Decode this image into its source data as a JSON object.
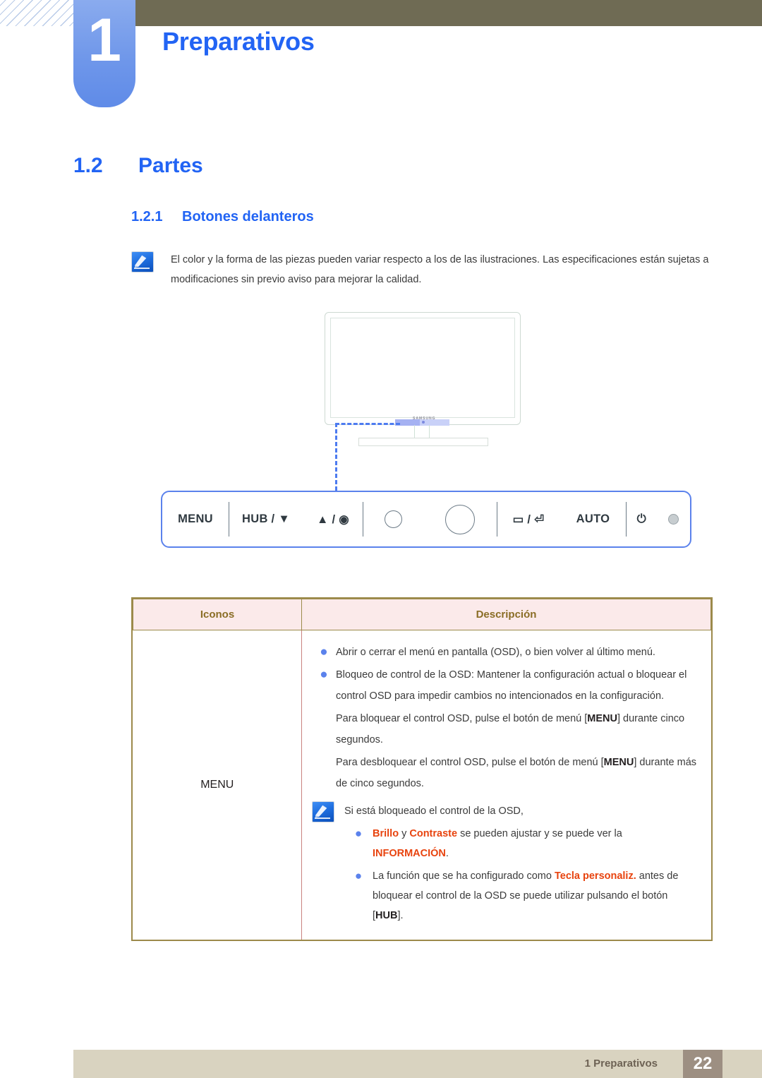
{
  "header": {
    "chapter_number": "1",
    "chapter_title": "Preparativos"
  },
  "headings": {
    "h1_number": "1.2",
    "h1_title": "Partes",
    "h2_number": "1.2.1",
    "h2_title": "Botones delanteros"
  },
  "note": {
    "icon": "note-pencil-icon",
    "text": "El color y la forma de las piezas pueden variar respecto a los de las ilustraciones. Las especificaciones están sujetas a modificaciones sin previo aviso para mejorar la calidad."
  },
  "illustration": {
    "name": "front-monitor-illustration",
    "brand_logo": "SAMSUNG"
  },
  "control_panel": {
    "groups": [
      {
        "name": "menu-group",
        "items": [
          {
            "type": "label",
            "text": "MENU",
            "name": "menu-button"
          }
        ]
      },
      {
        "name": "hub-updown-group",
        "items": [
          {
            "type": "label",
            "text": "HUB / ▼",
            "name": "hub-down-button"
          },
          {
            "type": "label",
            "text": "▲ / ◉",
            "name": "up-customkey-button"
          }
        ]
      },
      {
        "name": "circles-group",
        "items": [
          {
            "type": "circle-small",
            "name": "small-circle-button"
          },
          {
            "type": "circle-large",
            "name": "large-circle-button"
          }
        ]
      },
      {
        "name": "source-enter-auto-group",
        "items": [
          {
            "type": "label",
            "text": "▭ / ⏎",
            "name": "source-enter-button"
          },
          {
            "type": "label",
            "text": "AUTO",
            "name": "auto-button"
          }
        ]
      },
      {
        "name": "power-group",
        "items": [
          {
            "type": "label",
            "text": "⏻",
            "name": "power-button"
          },
          {
            "type": "led",
            "name": "power-led-indicator"
          }
        ]
      }
    ]
  },
  "table": {
    "headers": {
      "icons": "Iconos",
      "description": "Descripción"
    },
    "rows": [
      {
        "icon_label": "MENU",
        "bullets": [
          "Abrir o cerrar el menú en pantalla (OSD), o bien volver al último menú.",
          "Bloqueo de control de la OSD: Mantener la configuración actual o bloquear el control OSD para impedir cambios no intencionados en la configuración."
        ],
        "paragraph_1_before": "Para bloquear el control OSD, pulse el botón de menú [",
        "paragraph_1_key": "MENU",
        "paragraph_1_after": "] durante cinco segundos.",
        "paragraph_2_before": "Para desbloquear el control OSD, pulse el botón de menú [",
        "paragraph_2_key": "MENU",
        "paragraph_2_after": "] durante más de cinco segundos.",
        "inner_note": {
          "icon": "note-pencil-icon",
          "heading": "Si está bloqueado el control de la OSD,",
          "sub_bullets": [
            {
              "hl1": "Brillo",
              "mid1": " y ",
              "hl2": "Contraste",
              "mid2": " se pueden ajustar y se puede ver la ",
              "hl3": "INFORMACIÓN",
              "tail": "."
            },
            {
              "pre": "La función que se ha configurado como ",
              "hl": "Tecla personaliz.",
              "mid": " antes de bloquear el control de la OSD se puede utilizar pulsando el botón [",
              "key": "HUB",
              "tail": "]."
            }
          ]
        }
      }
    ]
  },
  "footer": {
    "text": "1 Preparativos",
    "page_number": "22"
  },
  "colors": {
    "accent_blue": "#2264f4",
    "tab_blue": "#6f97ea",
    "olive": "#6f6b54",
    "table_border": "#9c8a4b",
    "table_header_bg": "#fbeaea",
    "table_header_text": "#8a6d25",
    "highlight_orange": "#e8430e",
    "footer_bar": "#d9d3c0",
    "footer_page_bg": "#9d8f82"
  }
}
